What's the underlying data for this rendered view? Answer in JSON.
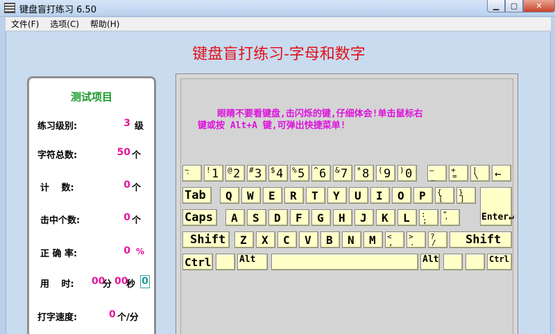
{
  "window": {
    "title": "键盘盲打练习 6.50",
    "min": "▁",
    "max": "▢",
    "close": "✕"
  },
  "menu": [
    "文件(F)",
    "选项(C)",
    "帮助(H)"
  ],
  "main_title": "键盘盲打练习-字母和数字",
  "stats": {
    "title": "测试项目",
    "level": {
      "label": "练习级别:",
      "value": "3",
      "unit": "级"
    },
    "total": {
      "label": "字符总数:",
      "value": "50",
      "unit": "个"
    },
    "count": {
      "label": "计　 数:",
      "value": "0",
      "unit": "个"
    },
    "hits": {
      "label": "击中个数:",
      "value": "0",
      "unit": "个"
    },
    "accuracy": {
      "label": "正 确 率:",
      "value": "0",
      "unit": "%"
    },
    "time": {
      "label": "用　 时:",
      "min": "00",
      "min_unit": "分",
      "sec": "00",
      "sec_unit": "秒",
      "box": "0"
    },
    "speed": {
      "label": "打字速度:",
      "value": "0",
      "unit": "个/分"
    }
  },
  "hint": {
    "line1": "眼睛不要看键盘,击闪烁的键,仔细体会!单击鼠标右",
    "line2": "键或按 Alt+A 键,可弹出快捷菜单!"
  },
  "keys": {
    "row1": [
      {
        "top": "~",
        "bottom": "`"
      },
      {
        "top": "!",
        "digit": "1"
      },
      {
        "top": "@",
        "digit": "2"
      },
      {
        "top": "#",
        "digit": "3"
      },
      {
        "top": "$",
        "digit": "4"
      },
      {
        "top": "%",
        "digit": "5"
      },
      {
        "top": "^",
        "digit": "6"
      },
      {
        "top": "&",
        "digit": "7"
      },
      {
        "top": "*",
        "digit": "8"
      },
      {
        "top": "(",
        "digit": "9"
      },
      {
        "top": ")",
        "digit": "0"
      },
      {
        "top": "—",
        "bottom": "_"
      },
      {
        "top": "+",
        "bottom": "="
      },
      {
        "top": "|",
        "bottom": "\\"
      },
      {
        "main": "←"
      }
    ],
    "row2": [
      "Tab",
      "Q",
      "W",
      "E",
      "R",
      "T",
      "Y",
      "U",
      "I",
      "O",
      "P"
    ],
    "row2_sym": [
      {
        "top": "{",
        "bottom": "["
      },
      {
        "top": "}",
        "bottom": "]"
      }
    ],
    "row3": [
      "Caps",
      "A",
      "S",
      "D",
      "F",
      "G",
      "H",
      "J",
      "K",
      "L"
    ],
    "row3_sym": [
      {
        "top": ":",
        "bottom": ";"
      },
      {
        "top": "\"",
        "bottom": "'"
      }
    ],
    "enter": "Enter↵",
    "row4": [
      "Shift",
      "Z",
      "X",
      "C",
      "V",
      "B",
      "N",
      "M"
    ],
    "row4_sym": [
      {
        "top": "<",
        "bottom": ","
      },
      {
        "top": ">",
        "bottom": "."
      },
      {
        "top": "?",
        "bottom": "/"
      }
    ],
    "shift_r": "Shift",
    "ctrl": "Ctrl",
    "alt": "Alt",
    "alt_r": "Alt",
    "ctrl_r": "Ctrl"
  }
}
